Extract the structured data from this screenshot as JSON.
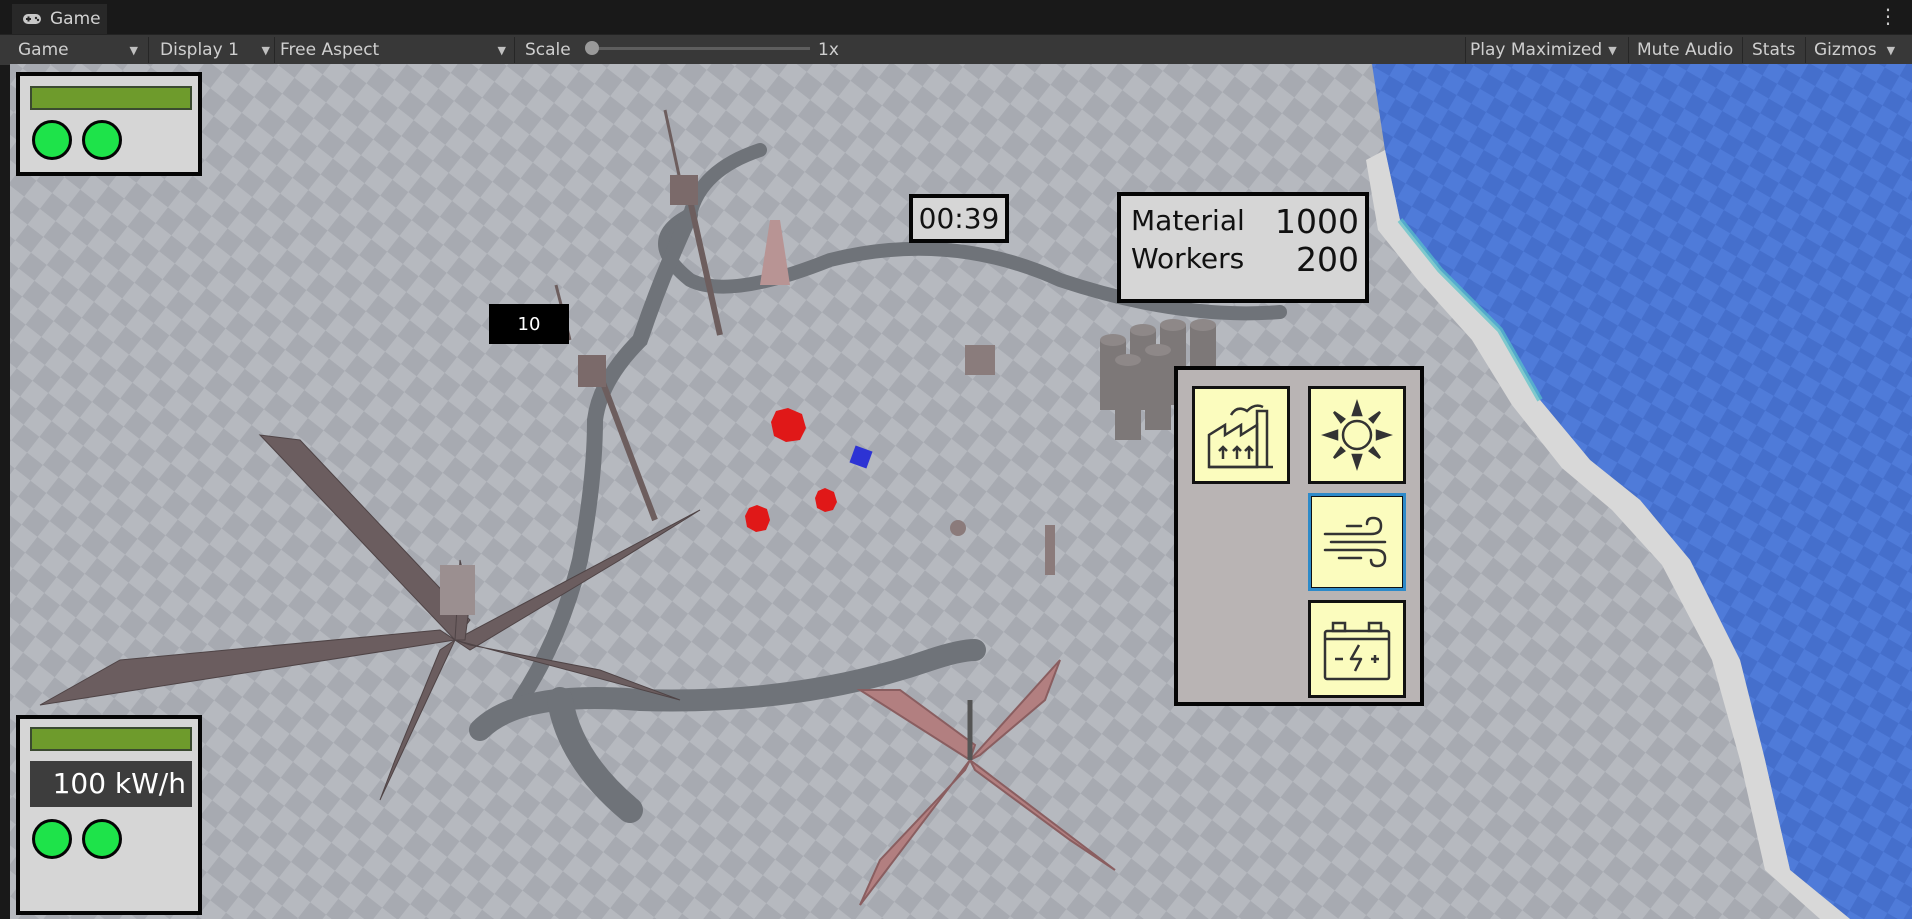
{
  "window": {
    "tab_title": "Game",
    "tab_icon": "gamepad-icon",
    "menu_icon": "kebab-menu-icon"
  },
  "toolbar": {
    "view_mode": "Game",
    "display": "Display 1",
    "aspect": "Free Aspect",
    "scale_label": "Scale",
    "scale_value": "1x",
    "play_mode": "Play Maximized",
    "mute_audio": "Mute Audio",
    "stats": "Stats",
    "gizmos": "Gizmos"
  },
  "hud": {
    "top_left_panel": {
      "bar_fill": 1.0,
      "indicators": 2
    },
    "bottom_left_panel": {
      "bar_fill": 1.0,
      "power_output": "100 kW/h",
      "indicators": 2
    },
    "timer": "00:39",
    "unit_tag": "10",
    "resources": [
      {
        "label": "Material",
        "value": "1000"
      },
      {
        "label": "Workers",
        "value": "200"
      }
    ],
    "build_menu": [
      {
        "name": "factory-icon",
        "selected": false
      },
      {
        "name": "solar-icon",
        "selected": false
      },
      {
        "name": "wind-icon",
        "selected": true
      },
      {
        "name": "battery-icon",
        "selected": false
      }
    ]
  },
  "colors": {
    "status_ok": "#1ee34a",
    "bar": "#6e9b2c",
    "build_bg": "#fbfcbe",
    "water": "#4d78d6"
  }
}
